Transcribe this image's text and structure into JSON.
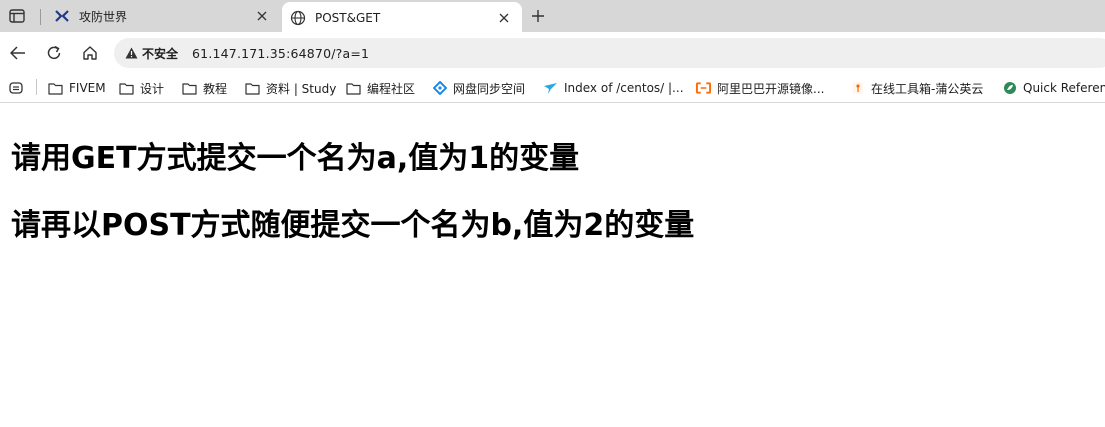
{
  "tabs": [
    {
      "title": "攻防世界",
      "icon": "xctf-logo-icon",
      "active": false
    },
    {
      "title": "POST&GET",
      "icon": "globe-icon",
      "active": true
    }
  ],
  "address_bar": {
    "security_label": "不安全",
    "url": "61.147.171.35:64870/?a=1"
  },
  "bookmarks": [
    {
      "label": "FIVEM",
      "icon": "folder-icon"
    },
    {
      "label": "设计",
      "icon": "folder-icon"
    },
    {
      "label": "教程",
      "icon": "folder-icon"
    },
    {
      "label": "资料 | Study",
      "icon": "folder-icon"
    },
    {
      "label": "编程社区",
      "icon": "folder-icon"
    },
    {
      "label": "网盘同步空间",
      "icon": "sync-diamond-icon"
    },
    {
      "label": "Index of /centos/ |...",
      "icon": "bird-icon"
    },
    {
      "label": "阿里巴巴开源镜像...",
      "icon": "aliyun-icon"
    },
    {
      "label": "在线工具箱-蒲公英云",
      "icon": "tool-icon"
    },
    {
      "label": "Quick Reference",
      "icon": "leaf-icon"
    }
  ],
  "page": {
    "heading_1": "请用GET方式提交一个名为a,值为1的变量",
    "heading_2": "请再以POST方式随便提交一个名为b,值为2的变量"
  },
  "colors": {
    "tabstrip_bg": "#d7d7d7",
    "omnibox_bg": "#efefef",
    "aliyun_orange": "#ff6a00",
    "xctf_blue": "#1f3a8a"
  }
}
